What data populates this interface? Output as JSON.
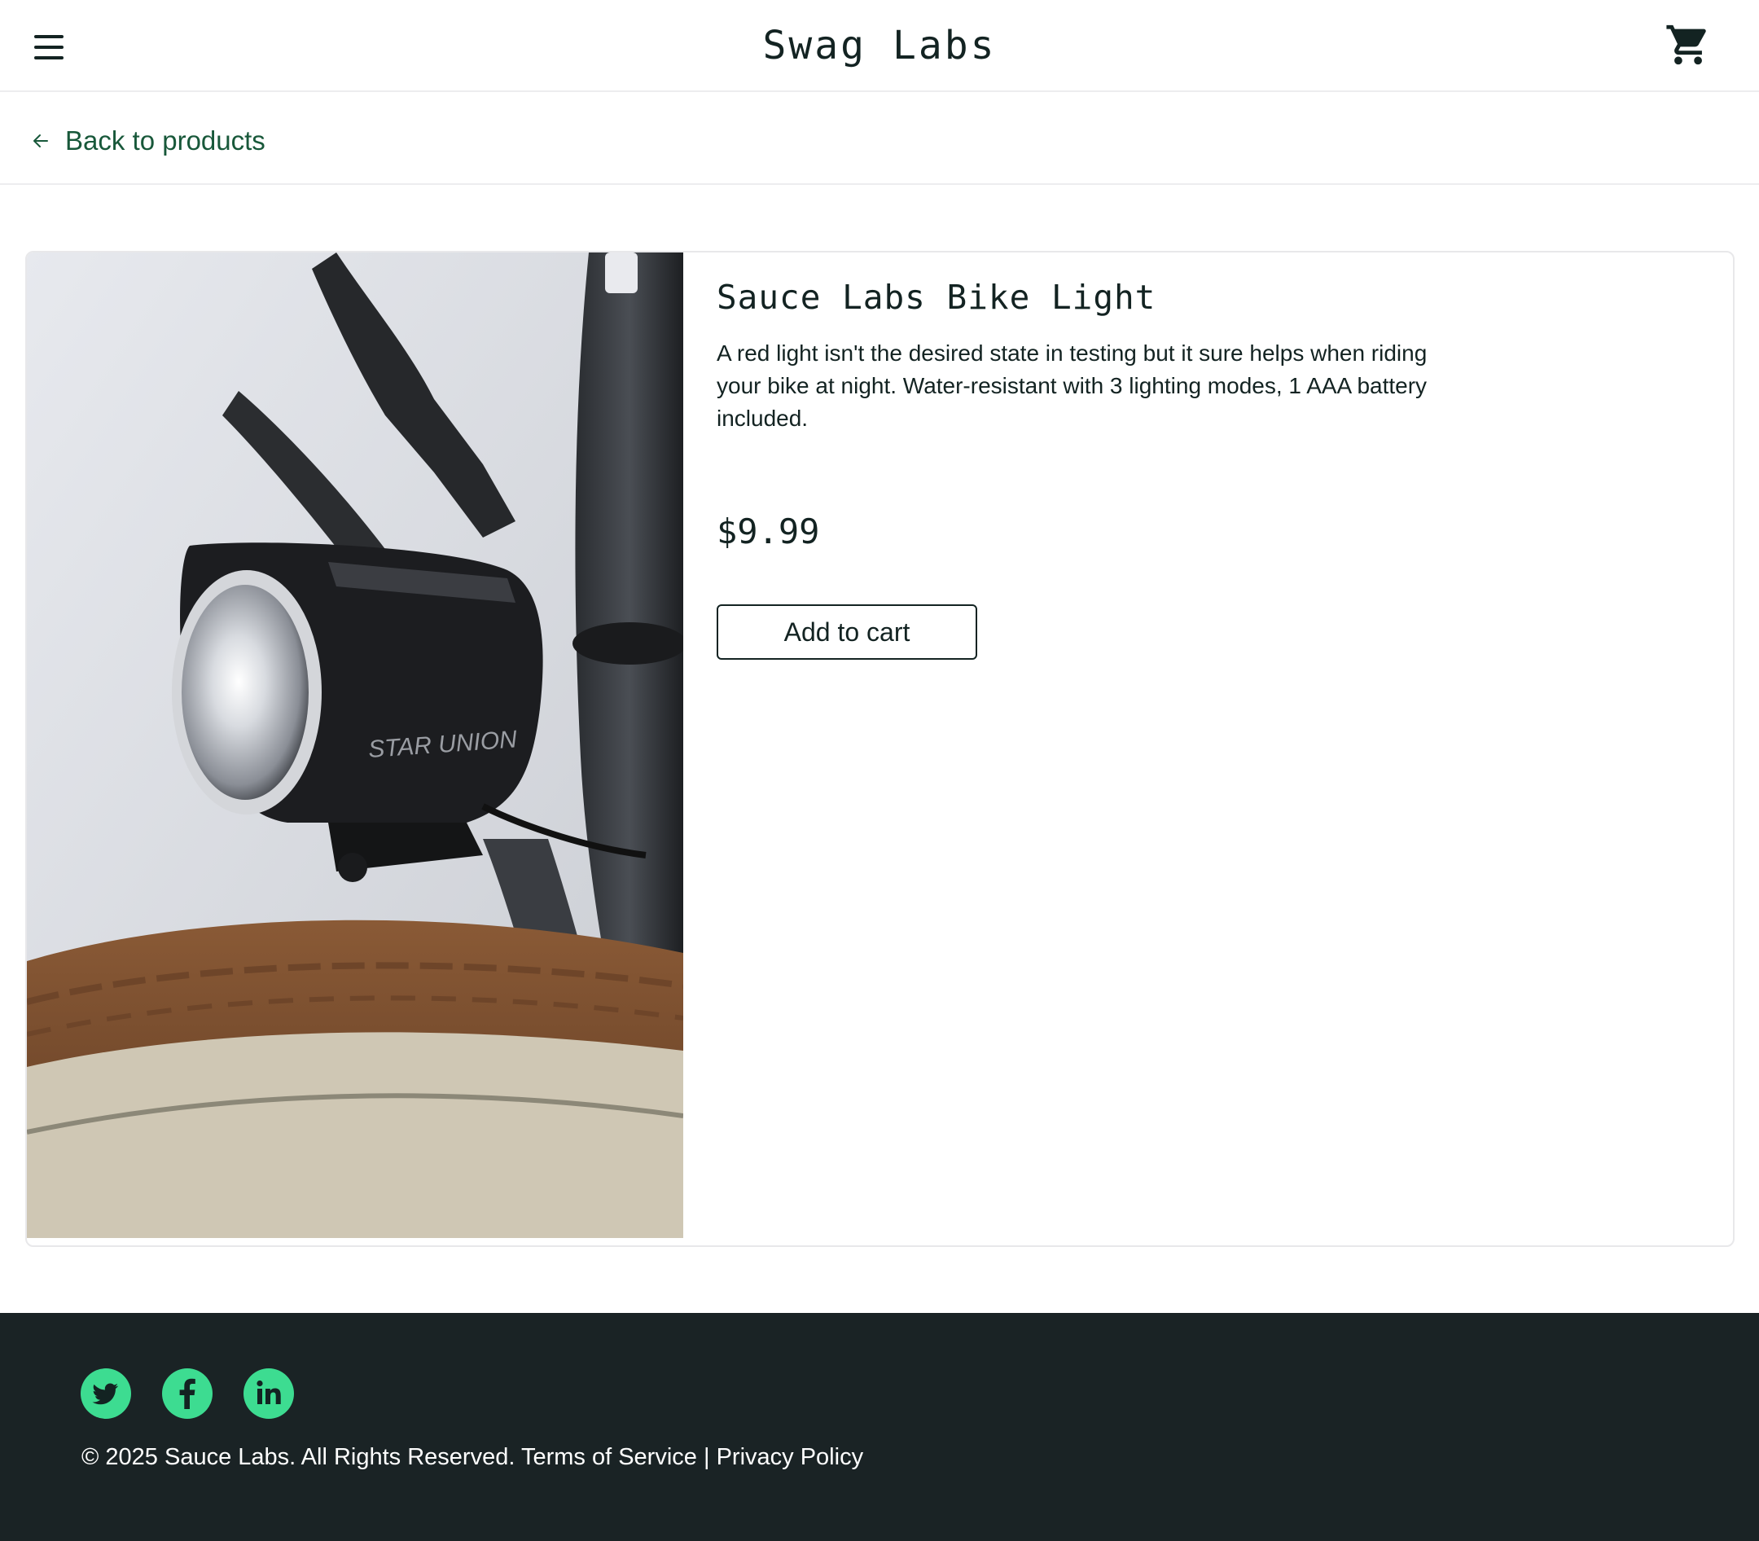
{
  "header": {
    "menu_icon": "hamburger-menu-icon",
    "logo": "Swag Labs",
    "cart_icon": "shopping-cart-icon"
  },
  "sub_header": {
    "back_label": "Back to products",
    "back_icon": "arrow-left-icon"
  },
  "product": {
    "name": "Sauce Labs Bike Light",
    "description": "A red light isn't the desired state in testing but it sure helps when riding your bike at night. Water-resistant with 3 lighting modes, 1 AAA battery included.",
    "price": "$9.99",
    "add_to_cart_label": "Add to cart",
    "image_brand_text": "STAR UNION"
  },
  "footer": {
    "social": [
      "twitter-icon",
      "facebook-icon",
      "linkedin-icon"
    ],
    "copyright": "© 2025 Sauce Labs. All Rights Reserved.",
    "terms_label": "Terms of Service",
    "separator": "|",
    "privacy_label": "Privacy Policy"
  },
  "colors": {
    "text": "#132322",
    "accent_green": "#18583a",
    "footer_bg": "#1a2325",
    "social_green": "#3ddc91",
    "divider": "#ededef"
  }
}
